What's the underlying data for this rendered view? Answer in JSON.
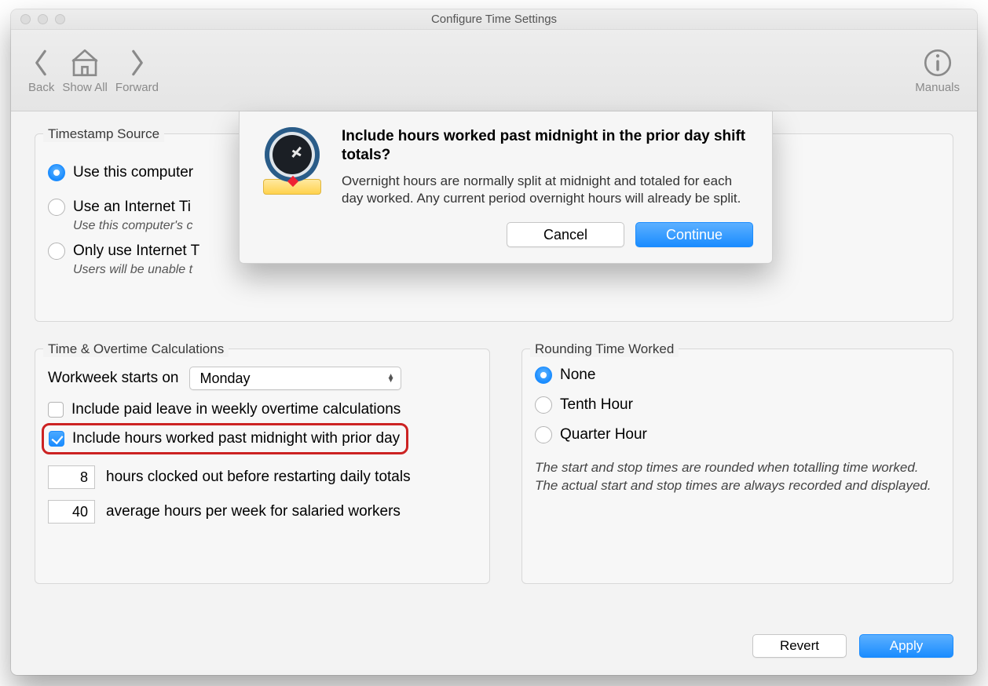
{
  "window_title": "Configure Time Settings",
  "toolbar": {
    "back": "Back",
    "show_all": "Show All",
    "forward": "Forward",
    "manuals": "Manuals"
  },
  "timestamp_source": {
    "label": "Timestamp Source",
    "opt1": "Use this computer",
    "opt2": "Use an Internet Ti",
    "opt2_hint": "Use this computer's c",
    "opt3": "Only use Internet T",
    "opt3_hint": "Users will be unable t"
  },
  "calc": {
    "label": "Time & Overtime Calculations",
    "workweek_label": "Workweek starts on",
    "workweek_value": "Monday",
    "include_paid_leave": "Include paid leave in weekly overtime calculations",
    "include_past_midnight": "Include hours worked past midnight with prior day",
    "hours_before_restart_value": "8",
    "hours_before_restart_label": "hours clocked out before restarting daily totals",
    "avg_hours_value": "40",
    "avg_hours_label": "average hours per week for salaried workers"
  },
  "rounding": {
    "label": "Rounding Time Worked",
    "none": "None",
    "tenth": "Tenth Hour",
    "quarter": "Quarter Hour",
    "hint": "The start and stop times are rounded when totalling time worked. The actual start and stop times are always recorded and displayed."
  },
  "footer": {
    "revert": "Revert",
    "apply": "Apply"
  },
  "modal": {
    "title": "Include hours worked past midnight in the prior day shift totals?",
    "body": "Overnight hours are normally split at midnight and totaled for each day worked. Any current period overnight hours will already be split.",
    "cancel": "Cancel",
    "continue": "Continue"
  }
}
